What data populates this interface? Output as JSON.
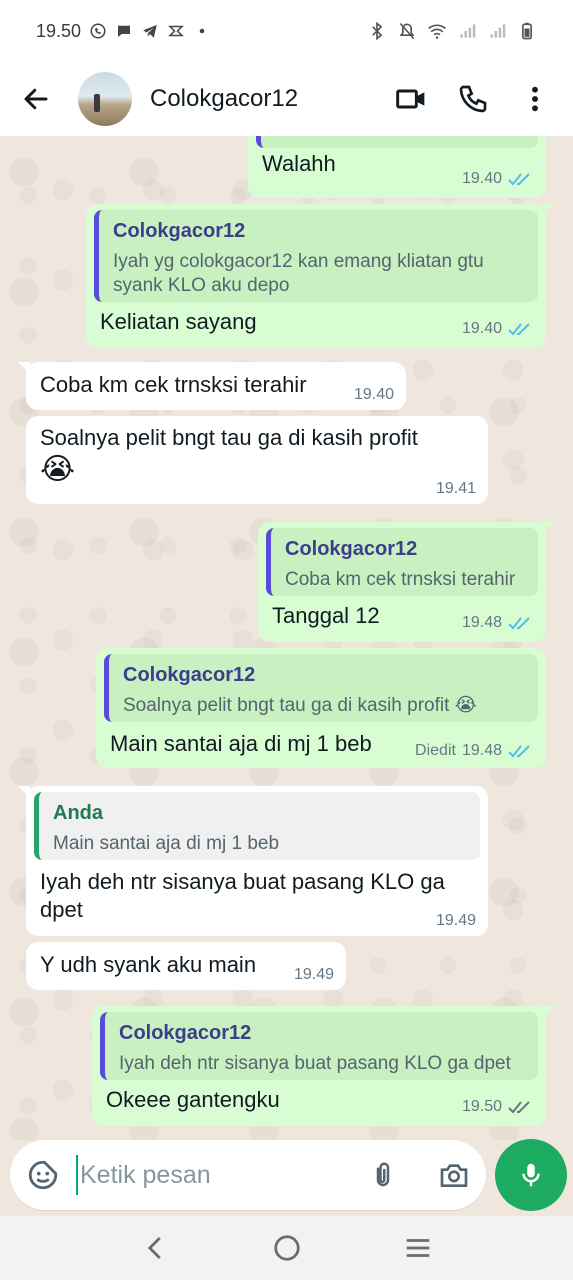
{
  "status_bar": {
    "time": "19.50"
  },
  "header": {
    "contact_name": "Colokgacor12"
  },
  "messages": [
    {
      "id": "m1",
      "direction": "out",
      "text": "Walahh",
      "time": "19.40",
      "status": "read"
    },
    {
      "id": "m2",
      "direction": "out",
      "quote_author": "Colokgacor12",
      "quote_text": "Iyah yg colokgacor12 kan emang kliatan gtu syank KLO aku depo",
      "text": "Keliatan sayang",
      "time": "19.40",
      "status": "read"
    },
    {
      "id": "m3",
      "direction": "in",
      "text": "Coba km cek trnsksi terahir",
      "time": "19.40"
    },
    {
      "id": "m4",
      "direction": "in",
      "text": "Soalnya pelit bngt tau ga di kasih profit",
      "emoji": "😭",
      "time": "19.41"
    },
    {
      "id": "m5",
      "direction": "out",
      "quote_author": "Colokgacor12",
      "quote_text": "Coba km cek trnsksi terahir",
      "text": "Tanggal 12",
      "time": "19.48",
      "status": "read"
    },
    {
      "id": "m6",
      "direction": "out",
      "quote_author": "Colokgacor12",
      "quote_text": "Soalnya pelit bngt tau ga di kasih profit 😭",
      "text": "Main santai aja di mj 1 beb",
      "edited_label": "Diedit",
      "time": "19.48",
      "status": "read"
    },
    {
      "id": "m7",
      "direction": "in",
      "quote_author": "Anda",
      "quote_text": "Main santai aja di mj 1 beb",
      "text": "Iyah deh ntr sisanya buat pasang KLO ga dpet",
      "time": "19.49"
    },
    {
      "id": "m8",
      "direction": "in",
      "text": "Y udh syank aku main",
      "time": "19.49"
    },
    {
      "id": "m9",
      "direction": "out",
      "quote_author": "Colokgacor12",
      "quote_text": "Iyah deh ntr sisanya buat pasang KLO ga dpet",
      "text": "Okeee gantengku",
      "time": "19.50",
      "status": "delivered"
    }
  ],
  "input": {
    "placeholder": "Ketik pesan"
  },
  "icons": {
    "back": "arrow-left-icon",
    "video_call": "video-camera-icon",
    "voice_call": "phone-icon",
    "menu": "more-vertical-icon",
    "sticker": "sticker-icon",
    "attach": "paperclip-icon",
    "camera": "camera-icon",
    "mic": "microphone-icon"
  },
  "colors": {
    "outgoing_bubble": "#d9fdd3",
    "incoming_bubble": "#ffffff",
    "read_tick": "#53bdeb",
    "accent_green": "#1daa61",
    "quote_bar_contact": "#5a4cdb",
    "quote_bar_self": "#25a56a"
  }
}
